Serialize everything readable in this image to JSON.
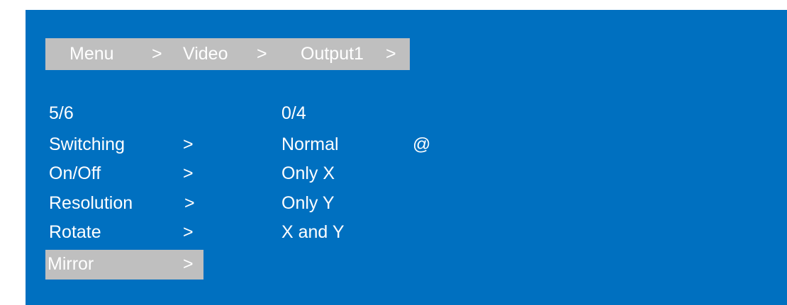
{
  "breadcrumb": {
    "items": [
      "Menu",
      ">",
      "Video",
      ">",
      "Output1",
      ">"
    ]
  },
  "left_menu": {
    "counter": "5/6",
    "items": [
      {
        "label": "Switching",
        "arrow": ">"
      },
      {
        "label": "On/Off",
        "arrow": ">"
      },
      {
        "label": "Resolution",
        "arrow": ">"
      },
      {
        "label": "Rotate",
        "arrow": ">"
      },
      {
        "label": "Mirror",
        "arrow": ">",
        "selected": true
      }
    ]
  },
  "right_menu": {
    "counter": "0/4",
    "items": [
      {
        "label": "Normal",
        "marker": "@"
      },
      {
        "label": "Only X"
      },
      {
        "label": "Only Y"
      },
      {
        "label": "X and Y"
      }
    ]
  },
  "colors": {
    "background": "#0070c0",
    "highlight": "#bfbfbf",
    "text": "#ffffff"
  }
}
